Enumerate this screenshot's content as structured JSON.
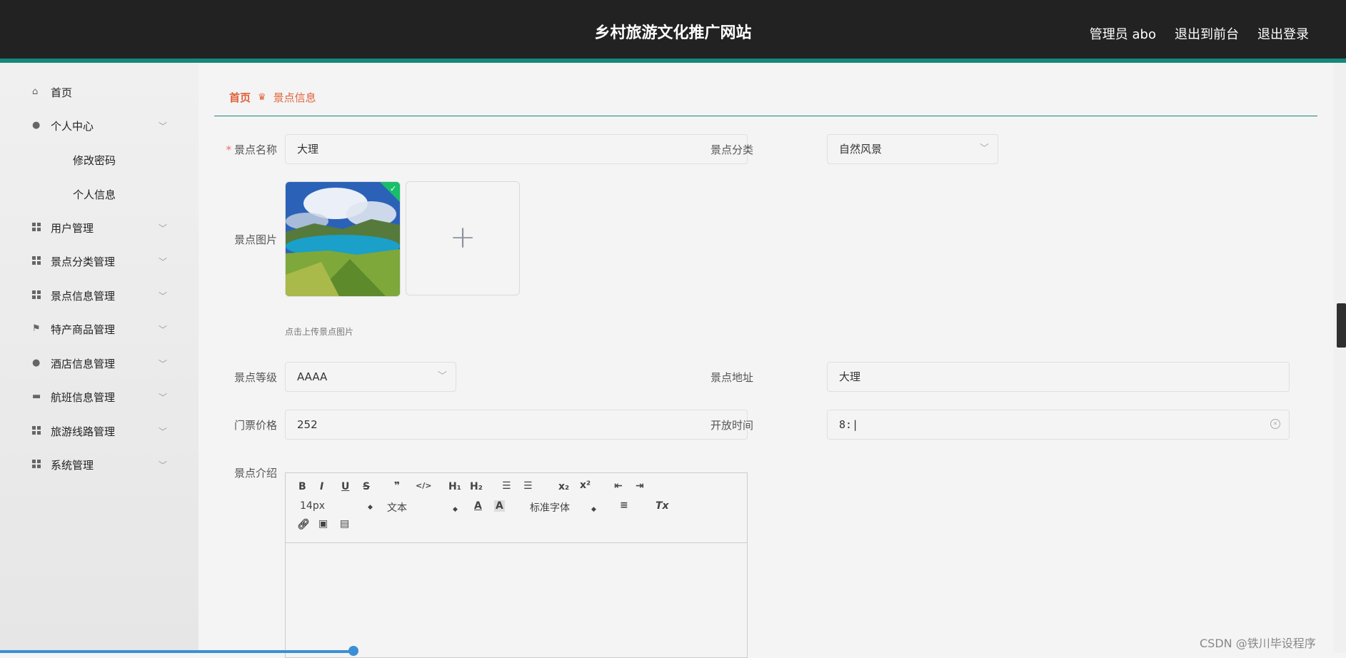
{
  "header": {
    "title": "乡村旅游文化推广网站",
    "admin_label": "管理员 abo",
    "to_front": "退出到前台",
    "logout": "退出登录"
  },
  "sidebar": {
    "items": [
      {
        "label": "首页"
      },
      {
        "label": "个人中心"
      },
      {
        "label": "修改密码"
      },
      {
        "label": "个人信息"
      },
      {
        "label": "用户管理"
      },
      {
        "label": "景点分类管理"
      },
      {
        "label": "景点信息管理"
      },
      {
        "label": "特产商品管理"
      },
      {
        "label": "酒店信息管理"
      },
      {
        "label": "航班信息管理"
      },
      {
        "label": "旅游线路管理"
      },
      {
        "label": "系统管理"
      }
    ]
  },
  "breadcrumb": {
    "home": "首页",
    "current": "景点信息"
  },
  "form": {
    "name_label": "景点名称",
    "name_value": "大理",
    "category_label": "景点分类",
    "category_value": "自然风景",
    "image_label": "景点图片",
    "upload_tip": "点击上传景点图片",
    "level_label": "景点等级",
    "level_value": "AAAA",
    "address_label": "景点地址",
    "address_value": "大理",
    "price_label": "门票价格",
    "price_value": "252",
    "hours_label": "开放时间",
    "hours_value": "8:",
    "intro_label": "景点介绍"
  },
  "editor": {
    "font_size": "14px",
    "block_type": "文本",
    "font_family": "标准字体"
  },
  "watermark": "CSDN @铁川毕设程序",
  "colors": {
    "accent": "#17877c",
    "breadcrumb": "#e0623a",
    "header_bg": "#222222"
  }
}
